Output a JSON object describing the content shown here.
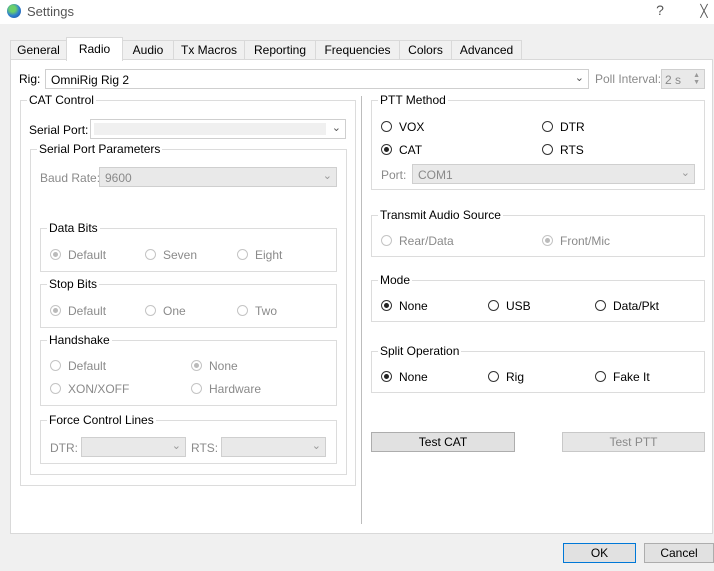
{
  "window": {
    "title": "Settings",
    "help_label": "?",
    "close_label": "╳"
  },
  "tabs": [
    {
      "label": "General"
    },
    {
      "label": "Radio"
    },
    {
      "label": "Audio"
    },
    {
      "label": "Tx Macros"
    },
    {
      "label": "Reporting"
    },
    {
      "label": "Frequencies"
    },
    {
      "label": "Colors"
    },
    {
      "label": "Advanced"
    }
  ],
  "active_tab": "Radio",
  "rig": {
    "label": "Rig:",
    "value": "OmniRig Rig 2",
    "poll_label": "Poll Interval:",
    "poll_value": "2 s"
  },
  "cat": {
    "title": "CAT Control",
    "serial_port_label": "Serial Port:",
    "serial_port_value": "",
    "params_title": "Serial Port Parameters",
    "baud_label": "Baud Rate:",
    "baud_value": "9600",
    "data_bits": {
      "title": "Data Bits",
      "options": [
        "Default",
        "Seven",
        "Eight"
      ],
      "selected": "Default"
    },
    "stop_bits": {
      "title": "Stop Bits",
      "options": [
        "Default",
        "One",
        "Two"
      ],
      "selected": "Default"
    },
    "handshake": {
      "title": "Handshake",
      "options": [
        "Default",
        "None",
        "XON/XOFF",
        "Hardware"
      ],
      "selected": "None"
    },
    "force": {
      "title": "Force Control Lines",
      "dtr_label": "DTR:",
      "rts_label": "RTS:"
    }
  },
  "ptt": {
    "title": "PTT Method",
    "options": [
      "VOX",
      "DTR",
      "CAT",
      "RTS"
    ],
    "selected": "CAT",
    "port_label": "Port:",
    "port_value": "COM1"
  },
  "tx_audio": {
    "title": "Transmit Audio Source",
    "options": [
      "Rear/Data",
      "Front/Mic"
    ],
    "selected": "Front/Mic"
  },
  "mode": {
    "title": "Mode",
    "options": [
      "None",
      "USB",
      "Data/Pkt"
    ],
    "selected": "None"
  },
  "split": {
    "title": "Split Operation",
    "options": [
      "None",
      "Rig",
      "Fake It"
    ],
    "selected": "None"
  },
  "buttons": {
    "test_cat": "Test CAT",
    "test_ptt": "Test PTT",
    "ok": "OK",
    "cancel": "Cancel"
  },
  "icons": {
    "app": "globe-icon",
    "combo_arrow": "chevron-down-icon",
    "spin": "spin-arrows-icon"
  }
}
